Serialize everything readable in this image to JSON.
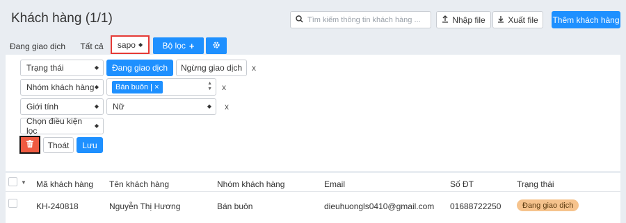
{
  "header": {
    "title": "Khách hàng (1/1)",
    "search_placeholder": "Tìm kiếm thông tin khách hàng ...",
    "import_label": "Nhập file",
    "export_label": "Xuất file",
    "add_label": "Thêm khách hàng"
  },
  "tabs": {
    "active": "Đang giao dịch",
    "all": "Tất cả",
    "saved_filter": "sapo",
    "filter_label": "Bộ lọc"
  },
  "filters": {
    "row1": {
      "field": "Trạng thái",
      "option_active": "Đang giao dịch",
      "option_inactive": "Ngừng giao dịch",
      "remove": "x"
    },
    "row2": {
      "field": "Nhóm khách hàng",
      "tag": "Bán buôn",
      "tag_remove": "×",
      "remove": "x"
    },
    "row3": {
      "field": "Giới tính",
      "value": "Nữ",
      "remove": "x"
    },
    "row4": {
      "field": "Chọn điều kiện lọc"
    },
    "exit_label": "Thoát",
    "save_label": "Lưu"
  },
  "table": {
    "columns": [
      "Mã khách hàng",
      "Tên khách hàng",
      "Nhóm khách hàng",
      "Email",
      "Số ĐT",
      "Trạng thái"
    ],
    "rows": [
      {
        "code": "KH-240818",
        "name": "Nguyễn Thị Hương",
        "group": "Bán buôn",
        "email": "dieuhuongls0410@gmail.com",
        "phone": "01688722250",
        "status": "Đang giao dịch"
      }
    ]
  },
  "colors": {
    "primary": "#1e90ff",
    "danger": "#ef5a41",
    "badge": "#f6c38d",
    "highlight": "#e53935"
  }
}
